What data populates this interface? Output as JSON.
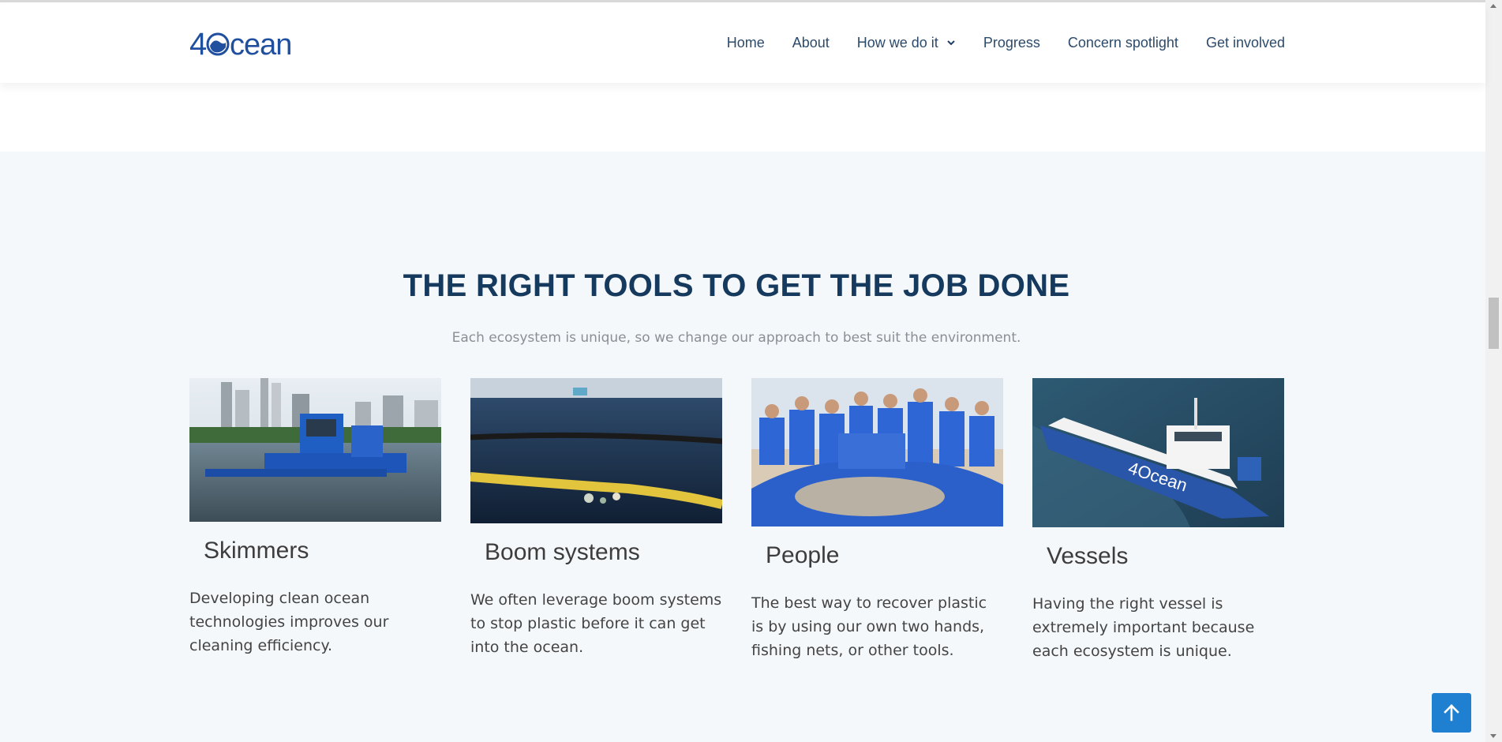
{
  "header": {
    "logo_text": "4Ocean",
    "nav": [
      {
        "label": "Home"
      },
      {
        "label": "About"
      },
      {
        "label": "How we do it",
        "has_dropdown": true
      },
      {
        "label": "Progress"
      },
      {
        "label": "Concern spotlight"
      },
      {
        "label": "Get involved"
      }
    ]
  },
  "section": {
    "title": "THE RIGHT TOOLS TO GET THE JOB DONE",
    "subtitle": "Each ecosystem is unique, so we change our approach to best suit the environment.",
    "cards": [
      {
        "name": "Skimmers",
        "description": "Developing clean ocean technologies improves our cleaning efficiency.",
        "image": "skimmer-boat-photo"
      },
      {
        "name": "Boom systems",
        "description": "We often leverage boom systems to stop plastic before it can get into the ocean.",
        "image": "boom-system-photo"
      },
      {
        "name": "People",
        "description": "The best way to recover plastic is by using our own two hands, fishing nets, or other tools.",
        "image": "volunteers-photo"
      },
      {
        "name": "Vessels",
        "description": "Having the right vessel is extremely important because each ecosystem is unique.",
        "image": "vessel-photo"
      }
    ]
  },
  "colors": {
    "brand_blue": "#1f4f9e",
    "heading": "#16395e",
    "nav_text": "#2c4a6b",
    "back_to_top": "#1f7fd0",
    "section_bg": "#f5f8fb"
  },
  "icons": {
    "dropdown": "chevron-down-icon",
    "back_to_top": "arrow-up-icon"
  }
}
